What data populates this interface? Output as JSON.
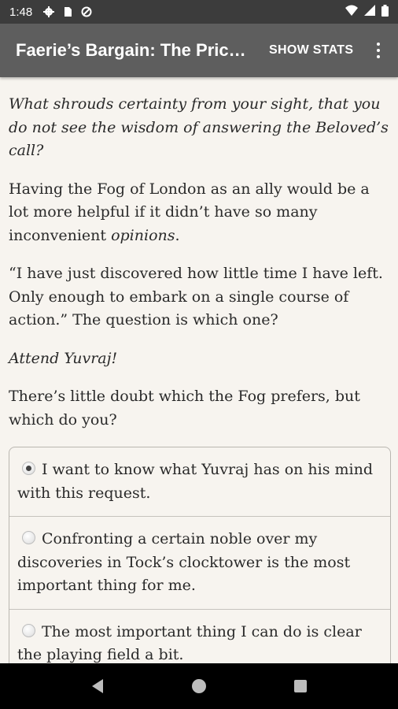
{
  "status_bar": {
    "time": "1:48",
    "left_icons": [
      "gear-icon",
      "sd-card-icon",
      "data-saver-icon"
    ],
    "right_icons": [
      "wifi-icon",
      "cell-signal-icon",
      "battery-icon"
    ]
  },
  "app_bar": {
    "title": "Faerie’s Bargain: The Price of Magic",
    "show_stats_label": "SHOW STATS",
    "overflow_icon": "more-vert-icon"
  },
  "story": {
    "paragraphs": [
      {
        "text": "What shrouds certainty from your sight, that you do not see the wisdom of answering the Beloved’s call?",
        "style": "italic"
      },
      {
        "text_before": "Having the Fog of London as an ally would be a lot more helpful if it didn’t have so many inconvenient ",
        "text_italic": "opinions",
        "text_after": "."
      },
      {
        "text": "“I have just discovered how little time I have left. Only enough to embark on a single course of action.” The question is which one?",
        "style": "normal"
      },
      {
        "text": "Attend Yuvraj!",
        "style": "italic"
      },
      {
        "text": "There’s little doubt which the Fog prefers, but which do you?",
        "style": "normal"
      }
    ]
  },
  "choices": [
    {
      "label": "I want to know what Yuvraj has on his mind with this request.",
      "selected": true
    },
    {
      "label": "Confronting a certain noble over my discoveries in Tock’s clocktower is the most important thing for me.",
      "selected": false
    },
    {
      "label": "The most important thing I can do is clear the playing field a bit.",
      "selected": false
    }
  ],
  "nav_bar": {
    "icons": [
      "back-icon",
      "home-icon",
      "recents-icon"
    ]
  },
  "colors": {
    "app_bar": "#5e5e5e",
    "status_bar": "#3c3c3c",
    "background": "#f7f4ef",
    "text": "#2a2a2a"
  }
}
